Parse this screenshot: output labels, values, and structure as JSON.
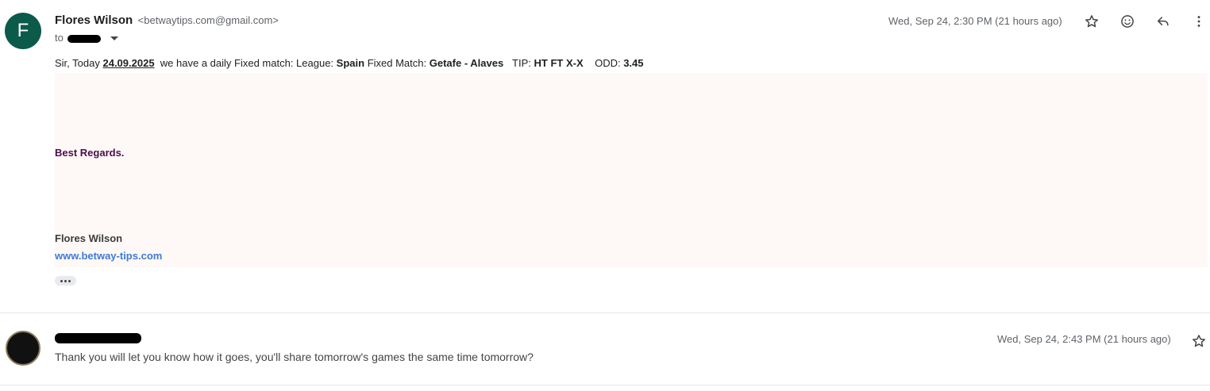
{
  "message1": {
    "avatar_letter": "F",
    "sender_name": "Flores Wilson",
    "sender_email": "<betwaytips.com@gmail.com>",
    "to_label": "to",
    "date": "Wed, Sep 24, 2:30 PM (21 hours ago)",
    "body": {
      "prefix": "Sir, Today",
      "date": "24.09.2025",
      "mid1": "we have a daily Fixed match: League:",
      "league": "Spain",
      "mid2": "Fixed Match:",
      "match": "Getafe - Alaves",
      "tip_label": "TIP:",
      "tip": "HT FT X-X",
      "odd_label": "ODD:",
      "odd": "3.45"
    },
    "regards": "Best Regards.",
    "signature_name": "Flores Wilson",
    "signature_link": "www.betway-tips.com"
  },
  "message2": {
    "date": "Wed, Sep 24, 2:43 PM (21 hours ago)",
    "preview": "Thank you will let you know how it goes, you'll share tomorrow's games the same time tomorrow?"
  },
  "icons": [
    "star-icon",
    "emoji-icon",
    "reply-icon",
    "more-vert-icon"
  ]
}
